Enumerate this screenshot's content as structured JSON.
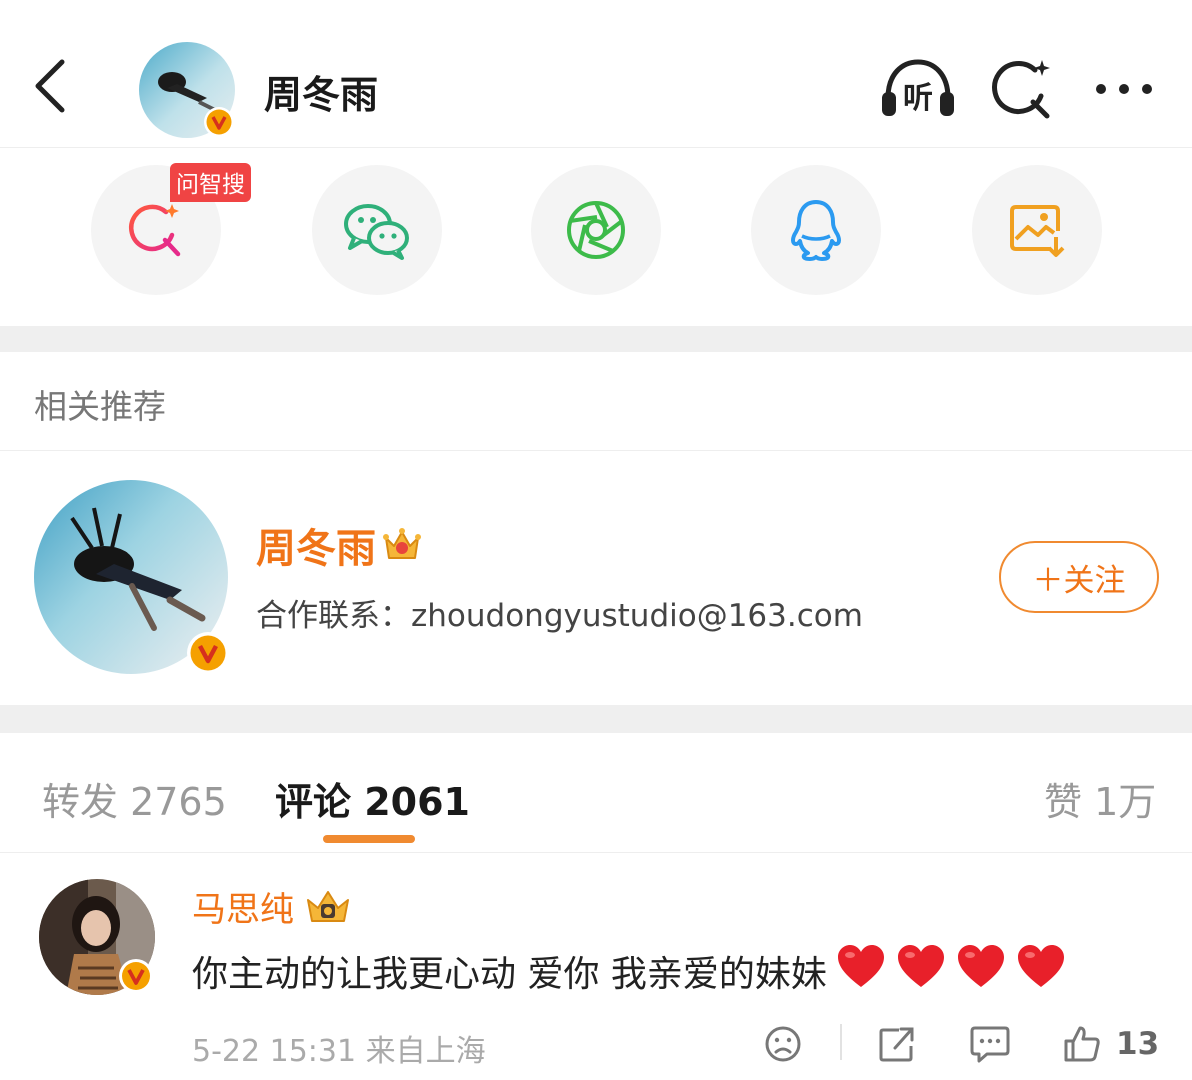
{
  "header": {
    "title": "周冬雨",
    "listen_label": "听"
  },
  "share": {
    "new_tag": "问智搜",
    "items": [
      "wen-zhi-sou",
      "wechat",
      "moments",
      "qq",
      "save-image"
    ]
  },
  "related": {
    "title": "相关推荐",
    "user": {
      "name": "周冬雨",
      "desc": "合作联系：zhoudongyustudio@163.com",
      "follow_label": "＋关注"
    }
  },
  "tabs": {
    "repost": "转发 2765",
    "comment": "评论 2061",
    "like": "赞 1万"
  },
  "comment": {
    "name": "马思纯",
    "text": "你主动的让我更心动 爱你 我亲爱的妹妹",
    "meta": "5-22 15:31 来自上海",
    "like_count": "13",
    "hearts": 4
  },
  "colors": {
    "accent": "#f07418",
    "verified": "#f5a000",
    "heart": "#e8202a"
  }
}
